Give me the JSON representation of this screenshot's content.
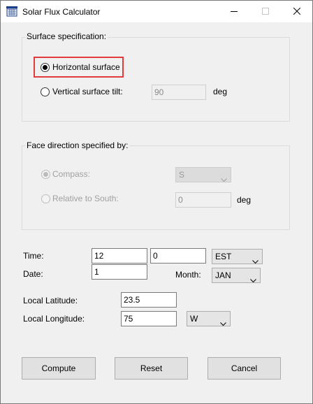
{
  "window": {
    "title": "Solar Flux Calculator"
  },
  "surface_group": {
    "legend": "Surface specification:",
    "horizontal_label": "Horizontal surface",
    "vertical_label": "Vertical surface tilt:",
    "tilt_value": "90",
    "tilt_unit": "deg"
  },
  "face_group": {
    "legend": "Face direction specified by:",
    "compass_label": "Compass:",
    "compass_value": "S",
    "relative_label": "Relative to South:",
    "relative_value": "0",
    "relative_unit": "deg"
  },
  "time": {
    "label": "Time:",
    "hour": "12",
    "minute": "0",
    "zone": "EST"
  },
  "date": {
    "label": "Date:",
    "day": "1",
    "month_label": "Month:",
    "month": "JAN"
  },
  "location": {
    "latitude_label": "Local Latitude:",
    "latitude": "23.5",
    "longitude_label": "Local Longitude:",
    "longitude": "75",
    "longitude_dir": "W"
  },
  "buttons": {
    "compute": "Compute",
    "reset": "Reset",
    "cancel": "Cancel"
  },
  "icons": {
    "app": "solar-panel-icon",
    "minimize": "minimize-icon",
    "maximize": "maximize-icon",
    "close": "close-icon",
    "dropdown": "chevron-down-icon"
  },
  "colors": {
    "highlight_border": "#e03c3c",
    "window_bg": "#f0f0f0"
  }
}
